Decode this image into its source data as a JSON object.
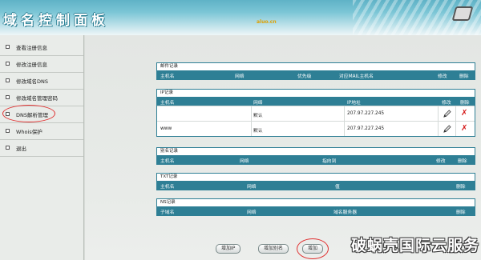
{
  "header": {
    "title": "域名控制面板",
    "domain_text": "aluo.cn"
  },
  "sidebar": {
    "items": [
      {
        "label": "查看注册信息"
      },
      {
        "label": "修改注册信息"
      },
      {
        "label": "修改域名DNS"
      },
      {
        "label": "修改域名管理密码"
      },
      {
        "label": "DNS解析管理"
      },
      {
        "label": "Whois保护"
      },
      {
        "label": "退出"
      }
    ],
    "highlighted_item": "DNS解析管理"
  },
  "sections": {
    "mail": {
      "title": "邮件记录",
      "headers": [
        "主机名",
        "网络",
        "优先级",
        "对应MAIL主机名",
        "修改",
        "删除"
      ]
    },
    "ip": {
      "title": "IP记录",
      "headers": [
        "主机名",
        "网络",
        "IP地址",
        "修改",
        "删除"
      ],
      "rows": [
        {
          "host": "",
          "network": "默认",
          "ip": "207.97.227.245",
          "edit_icon": "pencil-icon",
          "delete_icon": "x-icon"
        },
        {
          "host": "www",
          "network": "默认",
          "ip": "207.97.227.245",
          "edit_icon": "pencil-icon",
          "delete_icon": "x-icon"
        }
      ]
    },
    "alias": {
      "title": "别名记录",
      "headers": [
        "主机名",
        "网络",
        "指向到",
        "修改",
        "删除"
      ]
    },
    "txt": {
      "title": "TXT记录",
      "headers": [
        "主机名",
        "网络",
        "值",
        "删除"
      ]
    },
    "ns": {
      "title": "NS记录",
      "headers": [
        "子域名",
        "网络",
        "域名服务器",
        "删除"
      ]
    }
  },
  "buttons": {
    "add_ip": "增加IP",
    "add_alias": "增加别名",
    "add_third": "增加"
  },
  "watermark": "破蜗壳国际云服务",
  "colors": {
    "table_header": "#2e7f95",
    "delete_icon": "#d41818",
    "highlight_circle": "#e03030"
  }
}
